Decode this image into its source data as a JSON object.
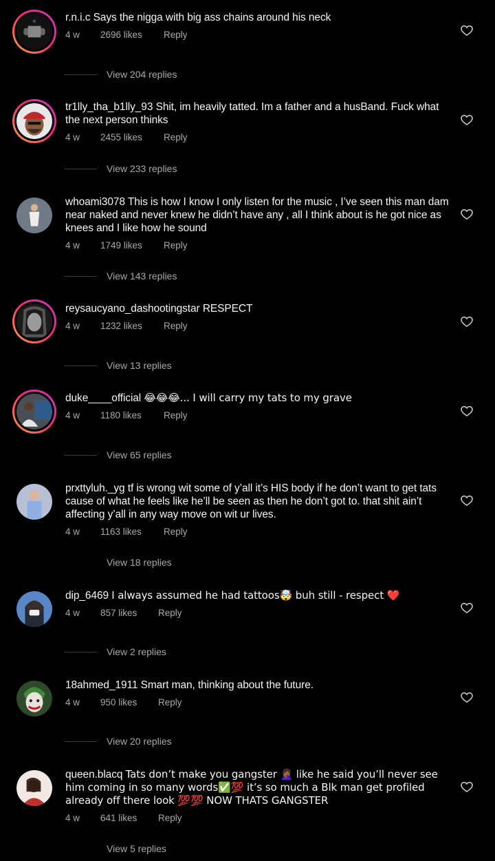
{
  "comments": [
    {
      "username": "r.n.i.c",
      "text": "Says the nigga with big ass chains around his neck",
      "time": "4 w",
      "likes": "2696 likes",
      "reply": "Reply",
      "view_replies": "View 204 replies"
    },
    {
      "username": "tr1lly_tha_b1lly_93",
      "text": "Shit, im heavily tatted. Im a father and a husBand. Fuck what the next person thinks",
      "time": "4 w",
      "likes": "2455 likes",
      "reply": "Reply",
      "view_replies": "View 233 replies"
    },
    {
      "username": "whoami3078",
      "text": "This is how I know I only listen for the music , I’ve seen this man dam near naked and never knew he didn’t have any , all I think about is he got nice as knees and I like how he sound",
      "time": "4 w",
      "likes": "1749 likes",
      "reply": "Reply",
      "view_replies": "View 143 replies"
    },
    {
      "username": "reysaucyano_dashootingstar",
      "text": "RESPECT",
      "time": "4 w",
      "likes": "1232 likes",
      "reply": "Reply",
      "view_replies": "View 13 replies"
    },
    {
      "username": "duke____official",
      "text": "😂😂😂... I will carry my tats to my grave",
      "time": "4 w",
      "likes": "1180 likes",
      "reply": "Reply",
      "view_replies": "View 65 replies"
    },
    {
      "username": "prxttyluh._yg",
      "text": "tf is wrong wit some of y’all it’s HIS body if he don’t want to get tats cause of what he feels like he’ll be seen as then he don’t got to. that shit ain’t affecting y’all in any way move on wit ur lives.",
      "time": "4 w",
      "likes": "1163 likes",
      "reply": "Reply",
      "view_replies": "View 18 replies"
    },
    {
      "username": "dip_6469",
      "text": "I always assumed he had tattoos🤯 buh still - respect ❤️",
      "time": "4 w",
      "likes": "857 likes",
      "reply": "Reply",
      "view_replies": "View 2 replies"
    },
    {
      "username": "18ahmed_1911",
      "text": "Smart man, thinking about the future.",
      "time": "4 w",
      "likes": "950 likes",
      "reply": "Reply",
      "view_replies": "View 20 replies"
    },
    {
      "username": "queen.blacq",
      "text": "Tats don’t make you gangster 🤦🏾‍♀️ like he said you’ll never see him coming in so many words✅💯 it’s so much a Blk man get profiled already off there look 💯💯 NOW THATS GANGSTER",
      "time": "4 w",
      "likes": "641 likes",
      "reply": "Reply",
      "view_replies": "View 5 replies"
    }
  ],
  "icons": {
    "like": "heart-outline-icon"
  },
  "colors": {
    "background": "#000000",
    "primary_text": "#f5f5f5",
    "secondary_text": "#a8a8a8",
    "story_ring_start": "#f9a23a",
    "story_ring_end": "#c23ac0"
  }
}
